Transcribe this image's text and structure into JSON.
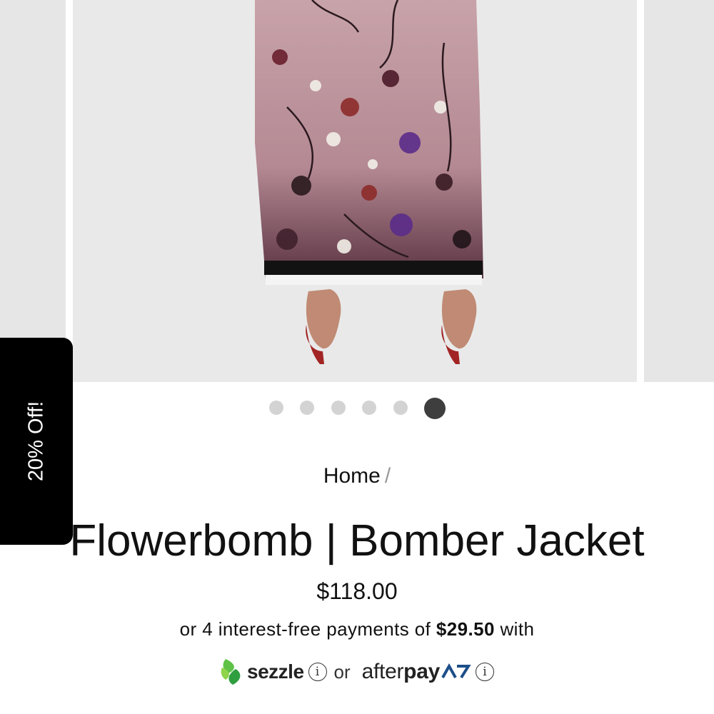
{
  "promo": {
    "label": "20% Off!"
  },
  "gallery": {
    "slide_count": 6,
    "active_index": 5
  },
  "breadcrumb": {
    "home": "Home",
    "separator": "/"
  },
  "product": {
    "title": "Flowerbomb | Bomber Jacket",
    "price": "$118.00"
  },
  "installments": {
    "prefix": "or 4 interest-free payments of",
    "amount": "$29.50",
    "suffix": "with"
  },
  "payment_options": {
    "sezzle": "sezzle",
    "or": "or",
    "afterpay_light": "after",
    "afterpay_bold": "pay"
  },
  "colors": {
    "promo_bg": "#000000",
    "dot_active": "#3e3e3e",
    "dot_inactive": "#d3d3d3",
    "sezzle_green": "#3bb54a",
    "afterpay_blue": "#1d4e89"
  },
  "icons": [
    "info-icon",
    "sezzle-logo",
    "afterpay-logo"
  ]
}
